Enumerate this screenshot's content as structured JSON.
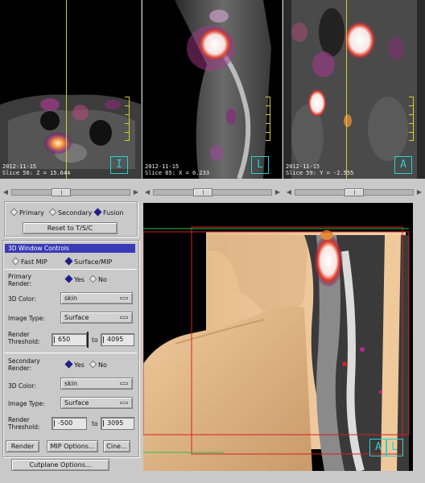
{
  "viewers": [
    {
      "date": "2012-11-15",
      "slice": "Slice 56: Z = 15.644",
      "orientation": "I"
    },
    {
      "date": "2012-11-15",
      "slice": "Slice 65: X = 0.233",
      "orientation": "L"
    },
    {
      "date": "2012-11-15",
      "slice": "Slice 59: Y = -2.555",
      "orientation": "A"
    }
  ],
  "sliders": [
    {
      "value": 0.4
    },
    {
      "value": 0.4
    },
    {
      "value": 0.5
    }
  ],
  "image_select": {
    "options": [
      "Primary",
      "Secondary",
      "Fusion"
    ],
    "selected": "Fusion",
    "reset_label": "Reset to T/S/C"
  },
  "window_controls": {
    "title": "3D Window Controls",
    "modes": [
      "Fast MIP",
      "Surface/MIP"
    ],
    "mode_selected": "Surface/MIP",
    "primary_render_label": "Primary\nRender:",
    "primary_render": {
      "yes": "Yes",
      "no": "No",
      "selected": "Yes"
    },
    "color_label_1": "3D Color:",
    "color_1": "skin",
    "image_type_label_1": "Image Type:",
    "image_type_1": "Surface",
    "threshold_label_1": "Render\nThreshold:",
    "threshold_1_min": "650",
    "threshold_1_max": "4095",
    "to_1": "to",
    "secondary_render_label": "Secondary\nRender:",
    "secondary_render": {
      "yes": "Yes",
      "no": "No",
      "selected": "Yes"
    },
    "color_label_2": "3D Color:",
    "color_2": "skin",
    "image_type_label_2": "Image Type:",
    "image_type_2": "Surface",
    "threshold_label_2": "Render\nThreshold:",
    "threshold_2_min": "-500",
    "threshold_2_max": "3095",
    "to_2": "to"
  },
  "buttons": {
    "render": "Render",
    "mip_options": "MIP Options...",
    "cine": "Cine...",
    "cutplane": "Cutplane Options..."
  },
  "view3d": {
    "orientation_marks": [
      "A",
      "L"
    ]
  },
  "colors": {
    "accent": "#3a39b6",
    "crosshair": "#d6cf2e",
    "orient_box": "#22d3d3"
  }
}
